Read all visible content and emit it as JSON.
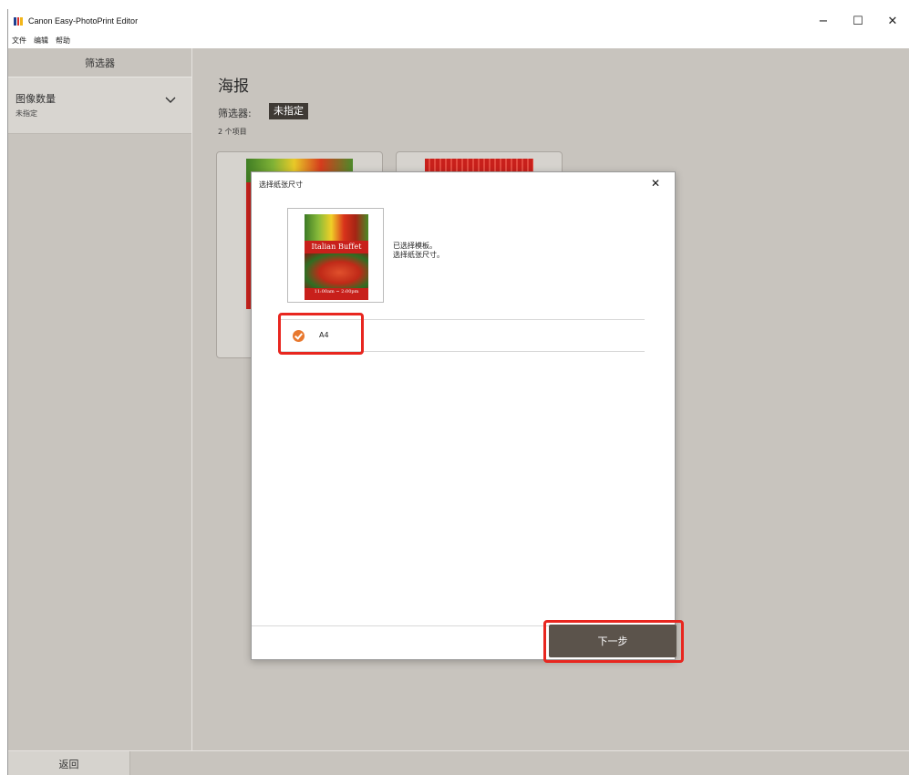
{
  "window": {
    "title": "Canon Easy-PhotoPrint Editor",
    "controls": {
      "minimize": "−",
      "maximize": "☐",
      "close": "✕"
    }
  },
  "menu": [
    "文件",
    "编辑",
    "帮助"
  ],
  "sidebar": {
    "header": "筛选器",
    "filter_group": {
      "title": "图像数量",
      "value": "未指定"
    }
  },
  "main": {
    "title": "海报",
    "filter_label": "筛选器:",
    "filter_chip": "未指定",
    "item_count": "2 个项目"
  },
  "poster": {
    "title": "Italian Buffet",
    "time": "11:00am ~ 2:00pm"
  },
  "dialog": {
    "title": "选择纸张尺寸",
    "close": "✕",
    "info_line1": "已选择模板。",
    "info_line2": "选择纸张尺寸。",
    "paper_sizes": [
      {
        "label": "A4",
        "selected": true
      }
    ],
    "next_label": "下一步"
  },
  "bottom": {
    "back_label": "返回"
  },
  "colors": {
    "accent": "#e8782e",
    "highlight": "#e8261f",
    "button_dark": "#5b534b",
    "background": "#c8c4be"
  }
}
